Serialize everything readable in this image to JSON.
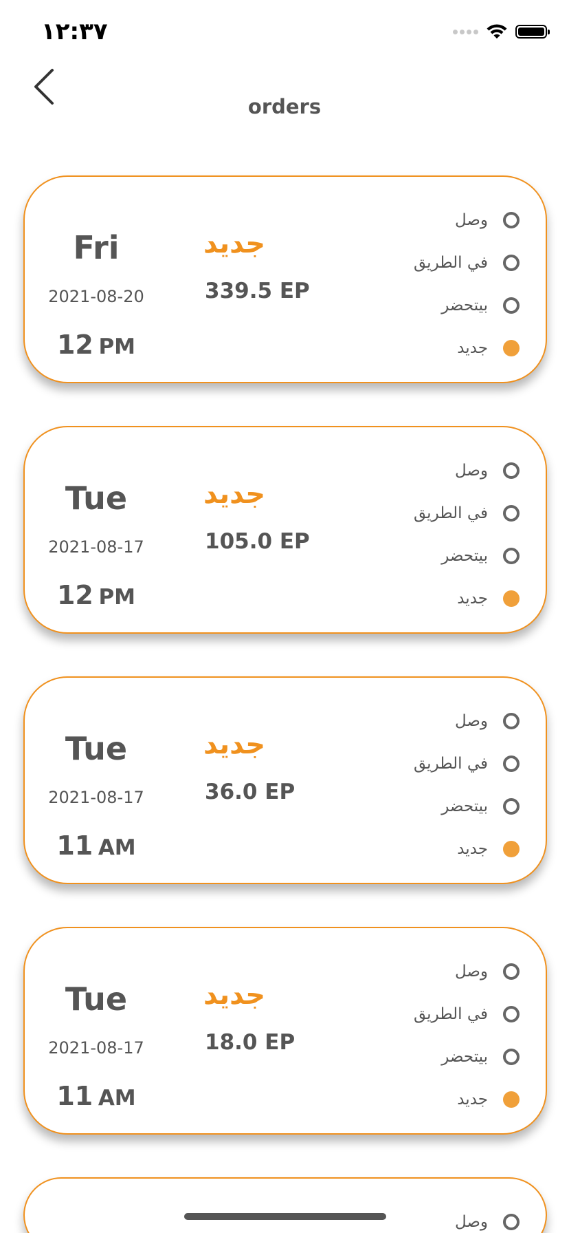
{
  "status_bar": {
    "time": "١٢:٣٧"
  },
  "header": {
    "title": "orders"
  },
  "colors": {
    "accent": "#f0911e",
    "active_dot": "#f0a03a",
    "text": "#555555"
  },
  "orders": [
    {
      "day": "Fri",
      "date": "2021-08-20",
      "hour": "12",
      "ampm": "PM",
      "status": "جديد",
      "price": "339.5 EP",
      "steps": [
        {
          "label": "وصل",
          "active": false
        },
        {
          "label": "في الطريق",
          "active": false
        },
        {
          "label": "بيتحضر",
          "active": false
        },
        {
          "label": "جديد",
          "active": true
        }
      ]
    },
    {
      "day": "Tue",
      "date": "2021-08-17",
      "hour": "12",
      "ampm": "PM",
      "status": "جديد",
      "price": "105.0 EP",
      "steps": [
        {
          "label": "وصل",
          "active": false
        },
        {
          "label": "في الطريق",
          "active": false
        },
        {
          "label": "بيتحضر",
          "active": false
        },
        {
          "label": "جديد",
          "active": true
        }
      ]
    },
    {
      "day": "Tue",
      "date": "2021-08-17",
      "hour": "11",
      "ampm": "AM",
      "status": "جديد",
      "price": "36.0 EP",
      "steps": [
        {
          "label": "وصل",
          "active": false
        },
        {
          "label": "في الطريق",
          "active": false
        },
        {
          "label": "بيتحضر",
          "active": false
        },
        {
          "label": "جديد",
          "active": true
        }
      ]
    },
    {
      "day": "Tue",
      "date": "2021-08-17",
      "hour": "11",
      "ampm": "AM",
      "status": "جديد",
      "price": "18.0 EP",
      "steps": [
        {
          "label": "وصل",
          "active": false
        },
        {
          "label": "في الطريق",
          "active": false
        },
        {
          "label": "بيتحضر",
          "active": false
        },
        {
          "label": "جديد",
          "active": true
        }
      ]
    }
  ],
  "partial_order": {
    "first_step_label": "وصل"
  }
}
